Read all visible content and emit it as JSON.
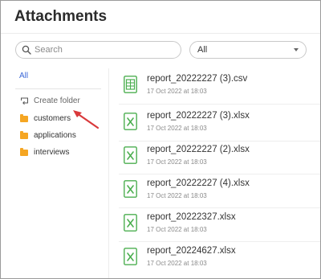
{
  "title": "Attachments",
  "search": {
    "placeholder": "Search"
  },
  "filter": {
    "selected": "All"
  },
  "sidebar": {
    "all_label": "All",
    "create_folder_label": "Create folder",
    "folders": [
      "customers",
      "applications",
      "interviews"
    ]
  },
  "files": [
    {
      "name": "report_20222227 (3).csv",
      "date": "17 Oct 2022 at 18:03",
      "type": "csv"
    },
    {
      "name": "report_20222227 (3).xlsx",
      "date": "17 Oct 2022 at 18:03",
      "type": "xlsx"
    },
    {
      "name": "report_20222227 (2).xlsx",
      "date": "17 Oct 2022 at 18:03",
      "type": "xlsx"
    },
    {
      "name": "report_20222227 (4).xlsx",
      "date": "17 Oct 2022 at 18:03",
      "type": "xlsx"
    },
    {
      "name": "report_20222327.xlsx",
      "date": "17 Oct 2022 at 18:03",
      "type": "xlsx"
    },
    {
      "name": "report_20224627.xlsx",
      "date": "17 Oct 2022 at 18:03",
      "type": "xlsx"
    }
  ],
  "colors": {
    "accent": "#3a66d6",
    "folder": "#f5a623",
    "file_icon": "#4caf50",
    "arrow": "#d9393b"
  },
  "icons": {
    "search": "search-icon",
    "create_folder": "create-folder-icon",
    "folder": "folder-icon",
    "csv": "csv-file-icon",
    "xlsx": "xlsx-file-icon"
  }
}
